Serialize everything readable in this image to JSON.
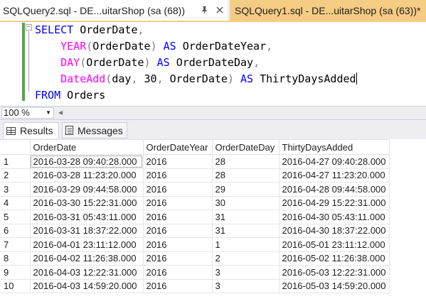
{
  "tabs": {
    "inactive_title": "SQLQuery2.sql - DE...uitarShop (sa (68))",
    "active_title": "SQLQuery1.sql - DE...uitarShop (sa (63))*"
  },
  "editor": {
    "collapse_symbol": "−",
    "lines": [
      [
        {
          "t": "SELECT ",
          "c": "kw"
        },
        {
          "t": "OrderDate",
          "c": ""
        },
        {
          "t": ",",
          "c": "gray"
        }
      ],
      [
        {
          "t": "    ",
          "c": ""
        },
        {
          "t": "YEAR",
          "c": "fn"
        },
        {
          "t": "(",
          "c": "gray"
        },
        {
          "t": "OrderDate",
          "c": ""
        },
        {
          "t": ")",
          "c": "gray"
        },
        {
          "t": " AS ",
          "c": "kw"
        },
        {
          "t": "OrderDateYear",
          "c": ""
        },
        {
          "t": ",",
          "c": "gray"
        }
      ],
      [
        {
          "t": "    ",
          "c": ""
        },
        {
          "t": "DAY",
          "c": "fn"
        },
        {
          "t": "(",
          "c": "gray"
        },
        {
          "t": "OrderDate",
          "c": ""
        },
        {
          "t": ")",
          "c": "gray"
        },
        {
          "t": " AS ",
          "c": "kw"
        },
        {
          "t": "OrderDateDay",
          "c": ""
        },
        {
          "t": ",",
          "c": "gray"
        }
      ],
      [
        {
          "t": "    ",
          "c": ""
        },
        {
          "t": "DateAdd",
          "c": "fn"
        },
        {
          "t": "(",
          "c": "gray"
        },
        {
          "t": "day",
          "c": ""
        },
        {
          "t": ", ",
          "c": "gray"
        },
        {
          "t": "30",
          "c": ""
        },
        {
          "t": ", ",
          "c": "gray"
        },
        {
          "t": "OrderDate",
          "c": ""
        },
        {
          "t": ")",
          "c": "gray"
        },
        {
          "t": " AS ",
          "c": "kw"
        },
        {
          "t": "ThirtyDaysAdded",
          "c": ""
        }
      ],
      [
        {
          "t": "FROM ",
          "c": "kw"
        },
        {
          "t": "Orders",
          "c": ""
        }
      ]
    ]
  },
  "zoom": {
    "value": "100 %",
    "arrow": "▼",
    "scroll_left": "◀"
  },
  "results_tabs": {
    "results_label": "Results",
    "messages_label": "Messages"
  },
  "grid": {
    "columns": [
      "OrderDate",
      "OrderDateYear",
      "OrderDateDay",
      "ThirtyDaysAdded"
    ],
    "rows": [
      [
        "1",
        "2016-03-28 09:40:28.000",
        "2016",
        "28",
        "2016-04-27 09:40:28.000"
      ],
      [
        "2",
        "2016-03-28 11:23:20.000",
        "2016",
        "28",
        "2016-04-27 11:23:20.000"
      ],
      [
        "3",
        "2016-03-29 09:44:58.000",
        "2016",
        "29",
        "2016-04-28 09:44:58.000"
      ],
      [
        "4",
        "2016-03-30 15:22:31.000",
        "2016",
        "30",
        "2016-04-29 15:22:31.000"
      ],
      [
        "5",
        "2016-03-31 05:43:11.000",
        "2016",
        "31",
        "2016-04-30 05:43:11.000"
      ],
      [
        "6",
        "2016-03-31 18:37:22.000",
        "2016",
        "31",
        "2016-04-30 18:37:22.000"
      ],
      [
        "7",
        "2016-04-01 23:11:12.000",
        "2016",
        "1",
        "2016-05-01 23:11:12.000"
      ],
      [
        "8",
        "2016-04-02 11:26:38.000",
        "2016",
        "2",
        "2016-05-02 11:26:38.000"
      ],
      [
        "9",
        "2016-04-03 12:22:31.000",
        "2016",
        "3",
        "2016-05-03 12:22:31.000"
      ],
      [
        "10",
        "2016-04-03 14:59:20.000",
        "2016",
        "3",
        "2016-05-03 14:59:20.000"
      ]
    ]
  },
  "colors": {
    "active_tab": "#f5cc84",
    "keyword": "#0000ff",
    "function": "#ff00ff",
    "change_bar": "#57a64a",
    "chrome": "#eeeef2"
  }
}
